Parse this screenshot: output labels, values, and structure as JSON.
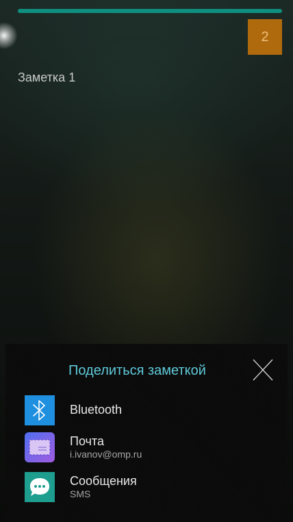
{
  "colors": {
    "accent_teal": "#0f8f7f",
    "badge_bg": "#b06a0e",
    "sheet_title": "#5fc9d9",
    "bluetooth_bg": "#1f8fe0",
    "mail_bg": "#6b5ce0",
    "messages_bg": "#1e9e8e"
  },
  "badge": {
    "count": "2"
  },
  "note": {
    "title": "Заметка 1"
  },
  "share_sheet": {
    "title": "Поделиться заметкой",
    "close_icon": "close-icon",
    "apps": [
      {
        "icon": "bluetooth-icon",
        "label": "Bluetooth",
        "sub": ""
      },
      {
        "icon": "mail-icon",
        "label": "Почта",
        "sub": "i.ivanov@omp.ru"
      },
      {
        "icon": "messages-icon",
        "label": "Сообщения",
        "sub": "SMS"
      }
    ]
  }
}
